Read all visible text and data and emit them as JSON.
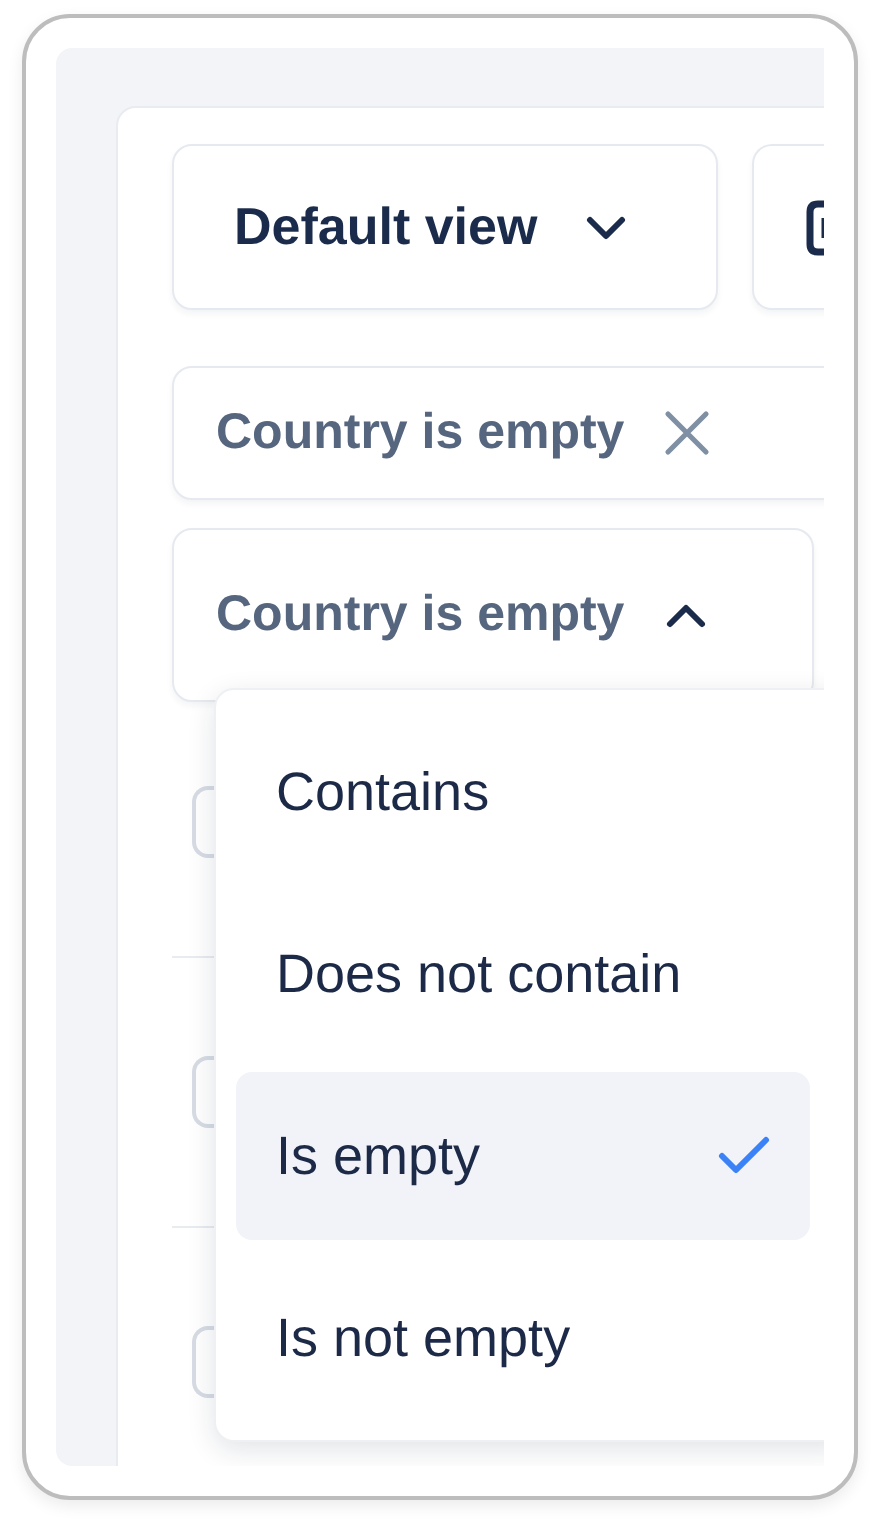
{
  "view_button": {
    "label": "Default view"
  },
  "filters": [
    {
      "label": "Country is empty",
      "expanded": false
    },
    {
      "label": "Country is empty",
      "expanded": true
    }
  ],
  "menu": {
    "items": [
      {
        "label": "Contains",
        "selected": false
      },
      {
        "label": "Does not contain",
        "selected": false
      },
      {
        "label": "Is empty",
        "selected": true
      },
      {
        "label": "Is not empty",
        "selected": false
      }
    ]
  }
}
